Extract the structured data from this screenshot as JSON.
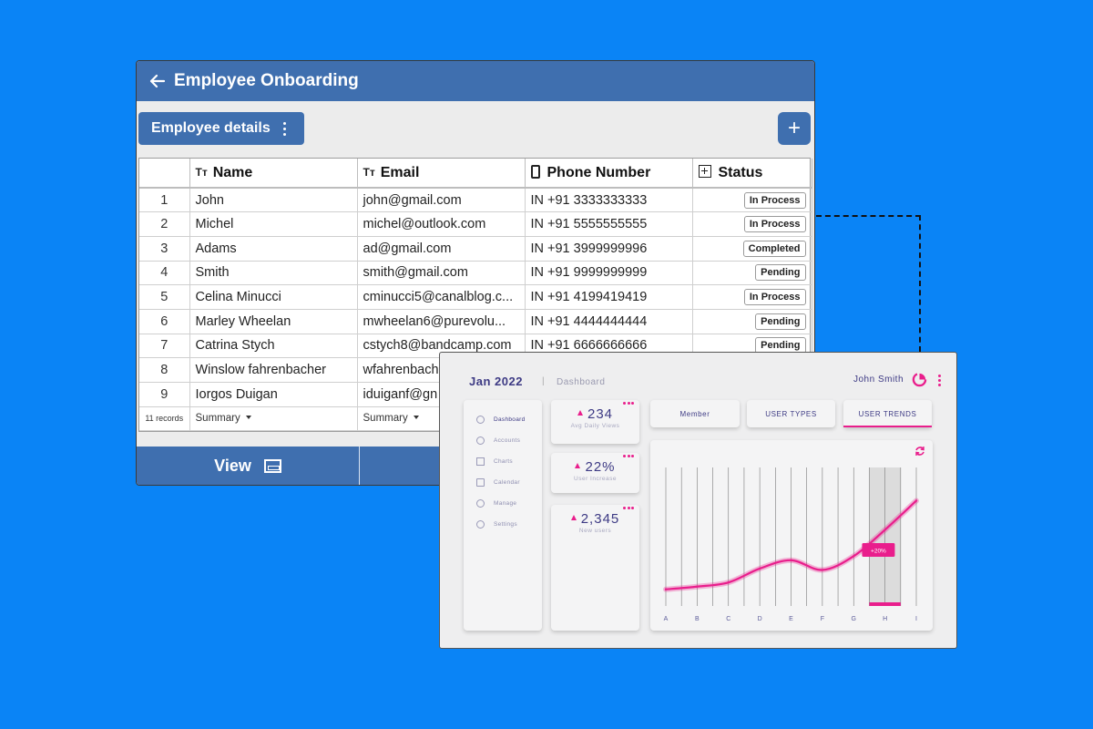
{
  "onboarding": {
    "title": "Employee Onboarding",
    "details_label": "Employee details",
    "add_label": "+",
    "columns": {
      "name": "Name",
      "email": "Email",
      "phone": "Phone Number",
      "status": "Status"
    },
    "rows": [
      {
        "n": "1",
        "name": "John",
        "email": "john@gmail.com",
        "phone": "IN +91 3333333333",
        "status": "In Process"
      },
      {
        "n": "2",
        "name": "Michel",
        "email": "michel@outlook.com",
        "phone": "IN +91 5555555555",
        "status": "In Process"
      },
      {
        "n": "3",
        "name": "Adams",
        "email": "ad@gmail.com",
        "phone": "IN +91 3999999996",
        "status": "Completed"
      },
      {
        "n": "4",
        "name": "Smith",
        "email": "smith@gmail.com",
        "phone": "IN +91 9999999999",
        "status": "Pending"
      },
      {
        "n": "5",
        "name": "Celina Minucci",
        "email": "cminucci5@canalblog.c...",
        "phone": "IN +91 4199419419",
        "status": "In Process"
      },
      {
        "n": "6",
        "name": "Marley Wheelan",
        "email": "mwheelan6@purevolu...",
        "phone": "IN +91 4444444444",
        "status": "Pending"
      },
      {
        "n": "7",
        "name": "Catrina Stych",
        "email": "cstych8@bandcamp.com",
        "phone": "IN +91 6666666666",
        "status": "Pending"
      },
      {
        "n": "8",
        "name": "Winslow fahrenbacher",
        "email": "wfahrenbach",
        "phone": "",
        "status": ""
      },
      {
        "n": "9",
        "name": "Iorgos Duigan",
        "email": "iduiganf@gn",
        "phone": "",
        "status": ""
      }
    ],
    "records_label": "11 records",
    "summary_label": "Summary",
    "view_label": "View"
  },
  "dashboard": {
    "title": "Jan 2022",
    "separator": "|",
    "breadcrumb": "Dashboard",
    "user": "John Smith",
    "nav": [
      "Dashboard",
      "Accounts",
      "Charts",
      "Calendar",
      "Manage",
      "Settings"
    ],
    "stats": [
      {
        "value": "234",
        "label": "Avg Daily Views"
      },
      {
        "value": "22%",
        "label": "User Increase"
      },
      {
        "value": "2,345",
        "label": "New users"
      }
    ],
    "tabs": [
      "Member",
      "USER TYPES",
      "USER TRENDS"
    ],
    "active_tab": "USER TRENDS",
    "accent_color": "#e91e8c",
    "primary_color": "#3d3a84"
  },
  "chart_data": {
    "type": "line",
    "categories": [
      "A",
      "B",
      "C",
      "D",
      "E",
      "F",
      "G",
      "H",
      "I"
    ],
    "series": [
      {
        "values": [
          0.12,
          0.14,
          0.17,
          0.27,
          0.33,
          0.26,
          0.36,
          0.55,
          0.76
        ]
      }
    ],
    "ylim": [
      0,
      1
    ],
    "grid": true,
    "highlight": {
      "category": "H",
      "label": "+20%"
    }
  }
}
